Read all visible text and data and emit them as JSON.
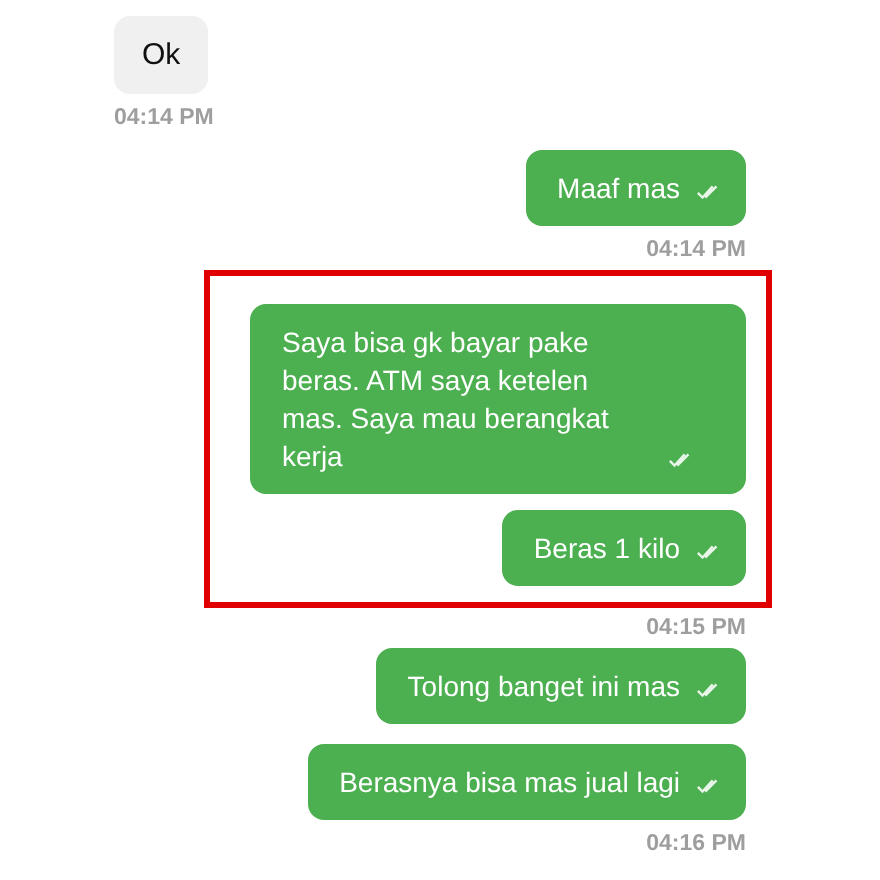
{
  "messages": [
    {
      "kind": "received",
      "text": "Ok",
      "highlighted": false
    },
    {
      "kind": "time_received",
      "text": "04:14 PM",
      "highlighted": false
    },
    {
      "kind": "sent",
      "text": "Maaf mas",
      "read": true,
      "highlighted": false
    },
    {
      "kind": "time_sent",
      "text": "04:14 PM",
      "highlighted": false
    },
    {
      "kind": "sent",
      "text": "Saya bisa gk bayar pake beras. ATM saya ketelen mas. Saya mau berangkat kerja",
      "read": true,
      "highlighted": true
    },
    {
      "kind": "sent",
      "text": "Beras 1 kilo",
      "read": true,
      "highlighted": true
    },
    {
      "kind": "time_sent",
      "text": "04:15 PM",
      "highlighted": false
    },
    {
      "kind": "sent",
      "text": "Tolong banget ini mas",
      "read": true,
      "highlighted": false
    },
    {
      "kind": "sent",
      "text": "Berasnya bisa mas jual lagi",
      "read": true,
      "highlighted": false
    },
    {
      "kind": "time_sent",
      "text": "04:16 PM",
      "highlighted": false
    }
  ]
}
